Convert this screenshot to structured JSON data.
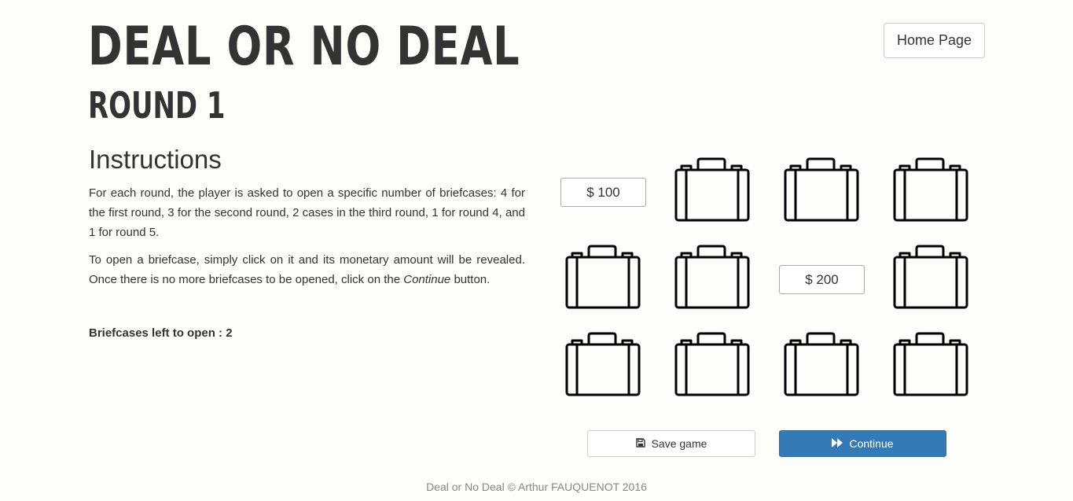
{
  "header": {
    "title": "DEAL OR NO DEAL",
    "round": "ROUND 1",
    "home_label": "Home Page"
  },
  "instructions": {
    "heading": "Instructions",
    "paragraph1": "For each round, the player is asked to open a specific number of briefcases: 4 for the first round, 3 for the second round, 2 cases in the third round, 1 for round 4, and 1 for round 5.",
    "paragraph2_before": "To open a briefcase, simply click on it and its monetary amount will be revealed. Once there is no more briefcases to be opened, click on the ",
    "paragraph2_em": "Continue",
    "paragraph2_after": " button.",
    "left_label": "Briefcases left to open : ",
    "left_count": "2"
  },
  "cases": [
    {
      "opened": true,
      "amount": "$ 100"
    },
    {
      "opened": false
    },
    {
      "opened": false
    },
    {
      "opened": false
    },
    {
      "opened": false
    },
    {
      "opened": false
    },
    {
      "opened": true,
      "amount": "$ 200"
    },
    {
      "opened": false
    },
    {
      "opened": false
    },
    {
      "opened": false
    },
    {
      "opened": false
    },
    {
      "opened": false
    }
  ],
  "actions": {
    "save_label": "Save game",
    "continue_label": "Continue",
    "save_icon": "floppy-disk-icon",
    "continue_icon": "fast-forward-icon",
    "continue_color": "#337ab7"
  },
  "footer": {
    "text": "Deal or No Deal © Arthur FAUQUENOT 2016"
  }
}
